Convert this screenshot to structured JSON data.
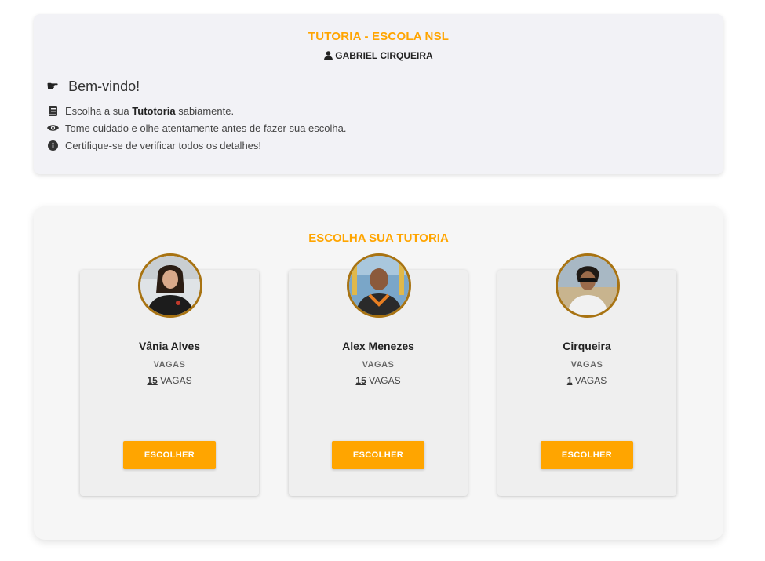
{
  "header": {
    "title": "TUTORIA - ESCOLA NSL",
    "user_name": "GABRIEL CIRQUEIRA",
    "welcome": "Bem-vindo!",
    "lines": [
      {
        "icon": "book-icon",
        "before": "Escolha a sua ",
        "bold": "Tutotoria",
        "after": " sabiamente."
      },
      {
        "icon": "eye-icon",
        "text": "Tome cuidado e olhe atentamente antes de fazer sua escolha."
      },
      {
        "icon": "info-circle-icon",
        "text": "Certifique-se de verificar todos os detalhes!"
      }
    ]
  },
  "main": {
    "section_title": "ESCOLHA SUA TUTORIA",
    "tutors": [
      {
        "name": "Vânia Alves",
        "vagas_label": "VAGAS",
        "vagas_count": "15",
        "vagas_suffix": " VAGAS",
        "button": "ESCOLHER"
      },
      {
        "name": "Alex Menezes",
        "vagas_label": "VAGAS",
        "vagas_count": "15",
        "vagas_suffix": " VAGAS",
        "button": "ESCOLHER"
      },
      {
        "name": "Cirqueira",
        "vagas_label": "VAGAS",
        "vagas_count": "1",
        "vagas_suffix": " VAGAS",
        "button": "ESCOLHER"
      }
    ]
  },
  "colors": {
    "accent": "#ffa500",
    "avatar_border": "#a87312"
  }
}
